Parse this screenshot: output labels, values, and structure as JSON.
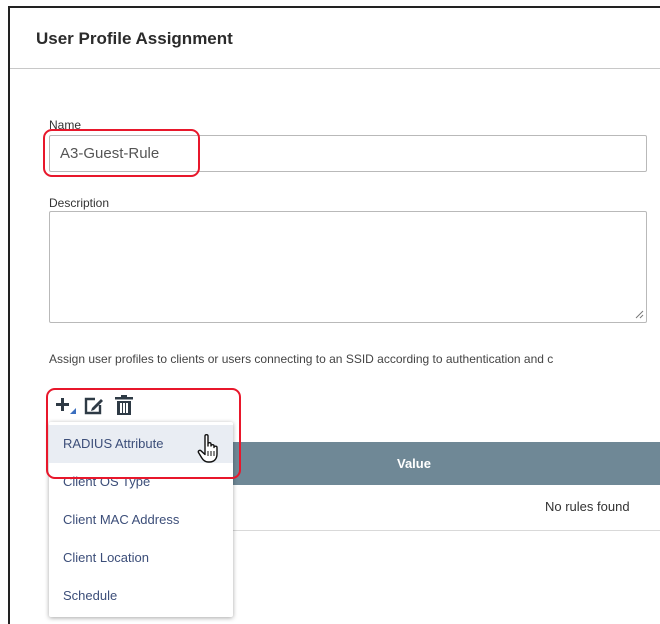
{
  "header": {
    "title": "User Profile Assignment"
  },
  "form": {
    "name_label": "Name",
    "name_value": "A3-Guest-Rule",
    "description_label": "Description",
    "description_value": "",
    "assign_text": "Assign user profiles to clients or users connecting to an SSID according to authentication and c"
  },
  "toolbar": {
    "add_icon": "plus-icon",
    "edit_icon": "edit-icon",
    "delete_icon": "trash-icon"
  },
  "dropdown": {
    "items": [
      {
        "label": "RADIUS Attribute"
      },
      {
        "label": "Client OS Type"
      },
      {
        "label": "Client MAC Address"
      },
      {
        "label": "Client Location"
      },
      {
        "label": "Schedule"
      }
    ]
  },
  "table": {
    "columns": [
      "Value"
    ],
    "empty_text": "No rules found"
  },
  "colors": {
    "highlight": "#e8172b",
    "table_header": "#6f8896",
    "menu_text": "#3c4e79"
  }
}
